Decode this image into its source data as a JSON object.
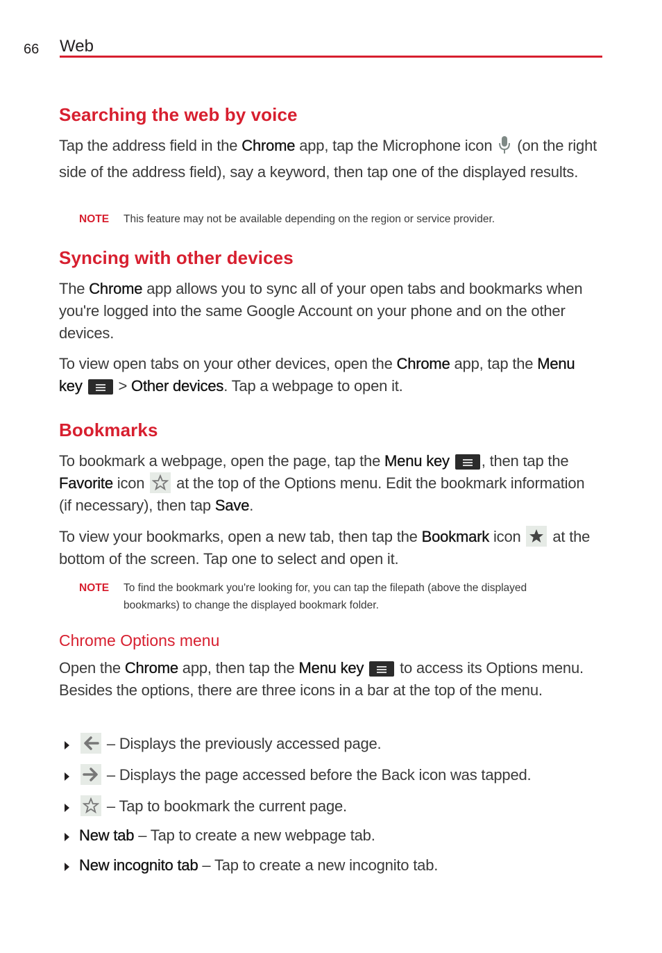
{
  "header": {
    "page_number": "66",
    "section": "Web",
    "accent_color": "#d71f2f"
  },
  "voice": {
    "title": "Searching the web by voice",
    "p1": [
      "Tap the address field in the ",
      "Chrome",
      " app, tap the Microphone icon ",
      "microphone-icon",
      " (on the right side of the address field), say a keyword, then tap one of the displayed results."
    ],
    "note_label": "NOTE",
    "note_text": "This feature may not be available depending on the region or service provider."
  },
  "sync": {
    "title": "Syncing with other devices",
    "p1": [
      "The ",
      "Chrome",
      " app allows you to sync all of your open tabs and bookmarks when you're logged into the same Google Account on your phone and on the other devices."
    ],
    "p2": [
      "To view open tabs on your other devices, open the ",
      "Chrome",
      " app, tap the ",
      "Menu key",
      "menu-key-icon",
      " > ",
      "Other devices",
      ". Tap a webpage to open it."
    ]
  },
  "bookmarks": {
    "title": "Bookmarks",
    "p1": [
      "To bookmark a webpage, open the page, tap the ",
      "Menu key",
      "menu-key-icon",
      ", then tap the ",
      "Favorite",
      " icon ",
      "star-outline-icon",
      " at the top of the Options menu. Edit the bookmark information (if necessary), then tap ",
      "Save",
      "."
    ],
    "p2": [
      "To view your bookmarks, open a new tab, then tap the ",
      "Bookmark",
      " icon ",
      "star-filled-icon",
      " at the bottom of the screen. Tap one to select and open it."
    ],
    "note_label": "NOTE",
    "note_text": "To find the bookmark you're looking for, you can tap the filepath (above the displayed bookmarks) to change the displayed bookmark folder."
  },
  "options": {
    "title": "Chrome Options menu",
    "p1": [
      "Open the ",
      "Chrome",
      " app, then tap the ",
      "Menu key",
      "menu-key-icon",
      " to access its Options menu. Besides the options, there are three icons in a bar at the top of the menu."
    ],
    "items": [
      {
        "icon": "back-arrow-icon",
        "bold": "",
        "text": " – Displays the previously accessed page."
      },
      {
        "icon": "forward-arrow-icon",
        "bold": "",
        "text": " – Displays the page accessed before the Back icon was tapped."
      },
      {
        "icon": "star-outline-icon",
        "bold": "",
        "text": " – Tap to bookmark the current page."
      },
      {
        "icon": "",
        "bold": "New tab",
        "text": " – Tap to create a new webpage tab."
      },
      {
        "icon": "",
        "bold": "New incognito tab",
        "text": " – Tap to create a new incognito tab."
      }
    ]
  }
}
